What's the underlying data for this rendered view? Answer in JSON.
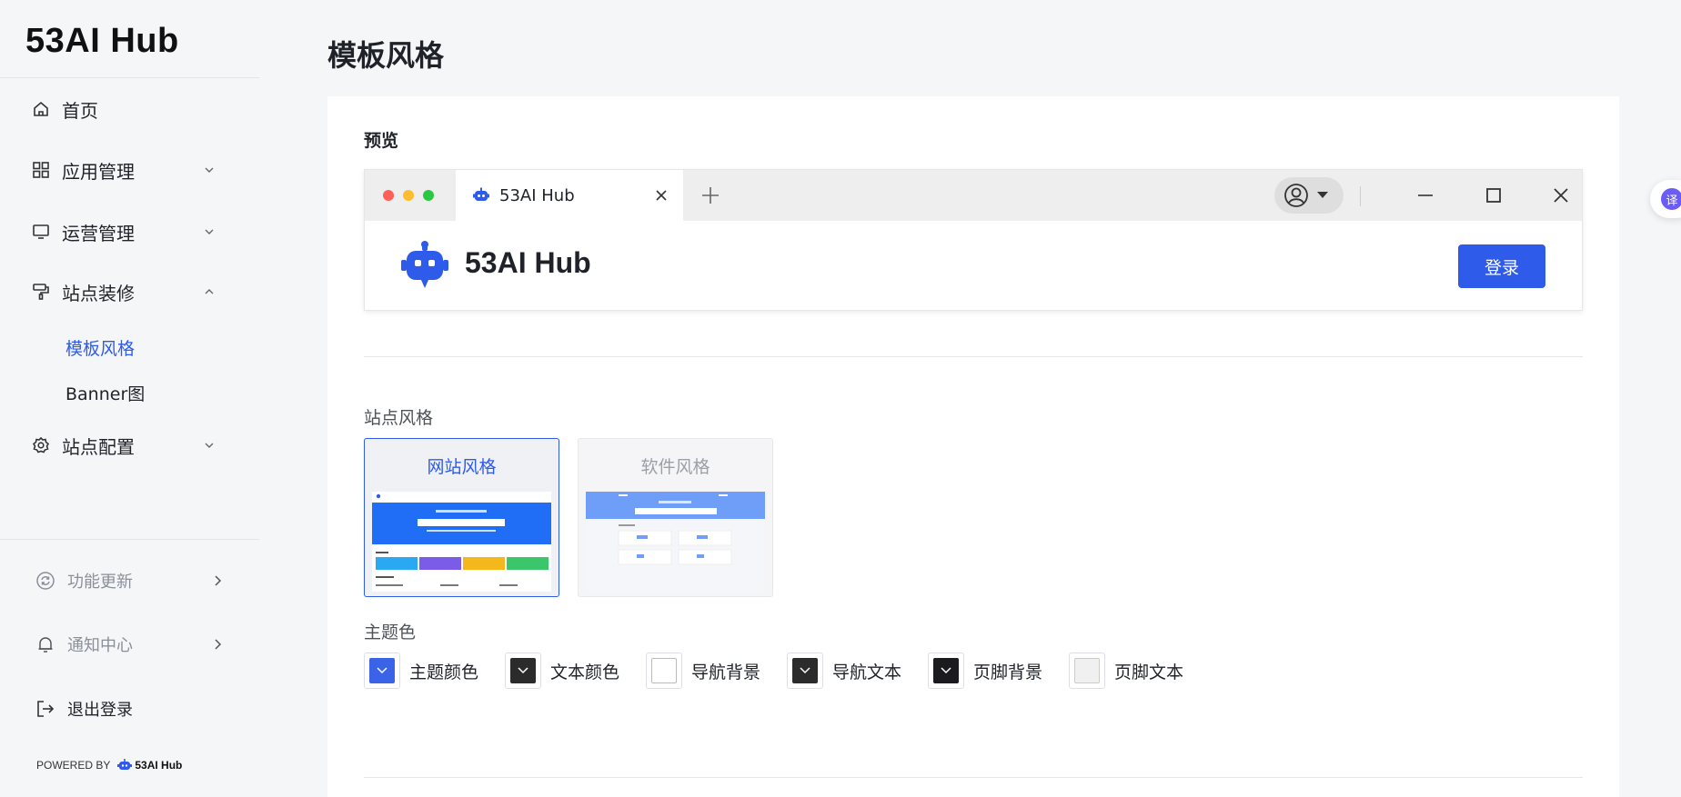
{
  "app": {
    "title": "53AI Hub"
  },
  "sidebar": {
    "items": [
      {
        "label": "首页"
      },
      {
        "label": "应用管理"
      },
      {
        "label": "运营管理"
      },
      {
        "label": "站点装修"
      },
      {
        "label": "站点配置"
      }
    ],
    "subitems": [
      {
        "label": "模板风格"
      },
      {
        "label": "Banner图"
      }
    ],
    "footer": [
      {
        "label": "功能更新"
      },
      {
        "label": "通知中心"
      },
      {
        "label": "退出登录"
      }
    ],
    "powered_by": "POWERED BY",
    "powered_brand": "53AI Hub"
  },
  "main": {
    "title": "模板风格",
    "preview_label": "预览",
    "browser": {
      "tab_title": "53AI Hub",
      "site_title": "53AI Hub",
      "login_label": "登录"
    },
    "site_style_label": "站点风格",
    "styles": [
      {
        "label": "网站风格",
        "selected": true
      },
      {
        "label": "软件风格",
        "selected": false
      }
    ],
    "theme_label": "主题色",
    "theme_colors": [
      {
        "label": "主题颜色",
        "color": "#3b63e8"
      },
      {
        "label": "文本颜色",
        "color": "#2b2b2b"
      },
      {
        "label": "导航背景",
        "color": "#ffffff"
      },
      {
        "label": "导航文本",
        "color": "#2b2b2b"
      },
      {
        "label": "页脚背景",
        "color": "#1b1b1f"
      },
      {
        "label": "页脚文本",
        "color": "#f0f0f0"
      }
    ]
  },
  "floating": {
    "translate_label": "译"
  },
  "colors": {
    "accent": "#2f5bea",
    "page_bg": "#f5f6f8"
  }
}
